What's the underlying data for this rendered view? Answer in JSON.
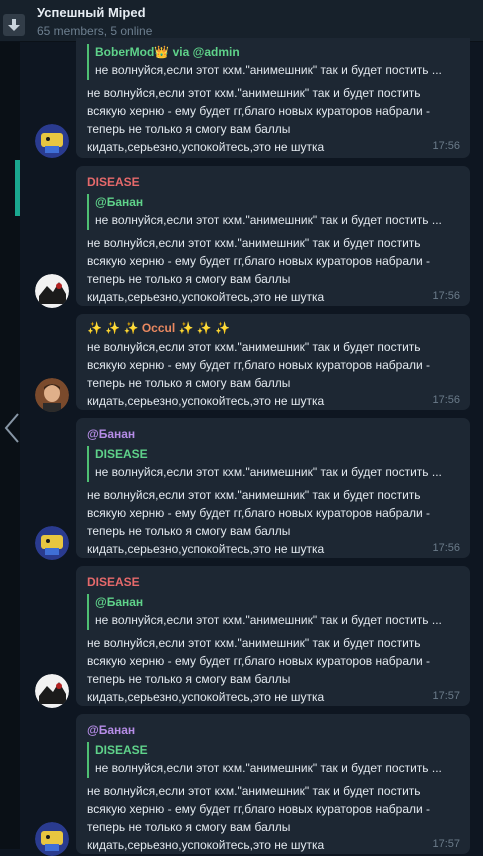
{
  "header": {
    "title": "Успешный Miped",
    "subtitle": "65 members, 5 online"
  },
  "colors": {
    "disease": "#e5696b",
    "banan": "#b58ce6",
    "occul": "#e98860",
    "quote_name": "#5fd28a",
    "accent": "#1aa78e"
  },
  "messages": [
    {
      "quote_name": "BoberMod👑 via @admin",
      "quote_text": "не волнуйся,если этот кхм.\"анимешник\" так и будет постить ...",
      "text": "не волнуйся,если этот кхм.\"анимешник\" так и будет постить\nвсякую херню - ему будет гг,благо новых кураторов набрали -\nтеперь не только я смогу вам баллы\nкидать,серьезно,успокойтесь,это не шутка",
      "time": "17:56"
    },
    {
      "sender": "DISEASE",
      "quote_name": "@Банан",
      "quote_text": "не волнуйся,если этот кхм.\"анимешник\" так и будет постить ...",
      "text": "не волнуйся,если этот кхм.\"анимешник\" так и будет постить\nвсякую херню - ему будет гг,благо новых кураторов набрали -\nтеперь не только я смогу вам баллы\nкидать,серьезно,успокойтесь,это не шутка",
      "time": "17:56"
    },
    {
      "sender": "✨ ✨ ✨ Occul ✨ ✨ ✨",
      "text": "не волнуйся,если этот кхм.\"анимешник\" так и будет постить\nвсякую херню - ему будет гг,благо новых кураторов набрали -\nтеперь не только я смогу вам баллы\nкидать,серьезно,успокойтесь,это не шутка",
      "time": "17:56"
    },
    {
      "sender": "@Банан",
      "quote_name": "DISEASE",
      "quote_text": "не волнуйся,если этот кхм.\"анимешник\" так и будет постить ...",
      "text": "не волнуйся,если этот кхм.\"анимешник\" так и будет постить\nвсякую херню - ему будет гг,благо новых кураторов набрали -\nтеперь не только я смогу вам баллы\nкидать,серьезно,успокойтесь,это не шутка",
      "time": "17:56"
    },
    {
      "sender": "DISEASE",
      "quote_name": "@Банан",
      "quote_text": "не волнуйся,если этот кхм.\"анимешник\" так и будет постить ...",
      "text": "не волнуйся,если этот кхм.\"анимешник\" так и будет постить\nвсякую херню - ему будет гг,благо новых кураторов набрали -\nтеперь не только я смогу вам баллы\nкидать,серьезно,успокойтесь,это не шутка",
      "time": "17:57"
    },
    {
      "sender": "@Банан",
      "quote_name": "DISEASE",
      "quote_text": "не волнуйся,если этот кхм.\"анимешник\" так и будет постить ...",
      "text": "не волнуйся,если этот кхм.\"анимешник\" так и будет постить\nвсякую херню - ему будет гг,благо новых кураторов набрали -\nтеперь не только я смогу вам баллы\nкидать,серьезно,успокойтесь,это не шутка",
      "time": "17:57"
    }
  ]
}
